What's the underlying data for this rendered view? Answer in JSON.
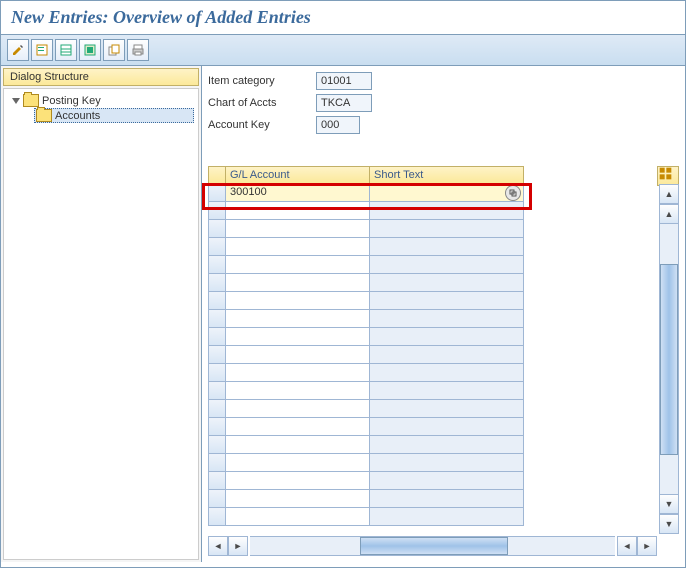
{
  "title": "New Entries: Overview of Added Entries",
  "toolbar": {
    "icons": [
      "pencil-icon",
      "form-icon",
      "table-icon",
      "select-icon",
      "copy-icon",
      "print-icon"
    ]
  },
  "sidebar": {
    "header": "Dialog Structure",
    "items": [
      {
        "label": "Posting Key",
        "expanded": true
      },
      {
        "label": "Accounts",
        "selected": true
      }
    ]
  },
  "form": {
    "rows": [
      {
        "label": "Item category",
        "value": "01001"
      },
      {
        "label": "Chart of Accts",
        "value": "TKCA"
      },
      {
        "label": "Account Key",
        "value": "000"
      }
    ]
  },
  "grid": {
    "columns": [
      "G/L Account",
      "Short Text"
    ],
    "rows": [
      {
        "gl": "300100",
        "st": ""
      }
    ],
    "empty_rows": 18
  }
}
